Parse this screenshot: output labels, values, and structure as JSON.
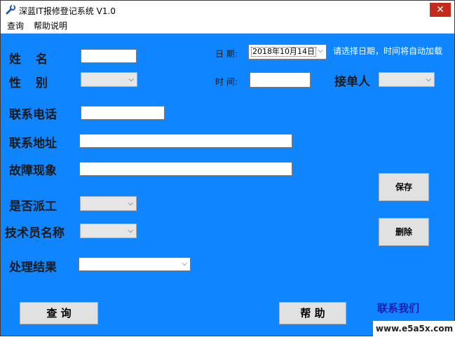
{
  "window": {
    "title": "深蓝IT报修登记系统 V1.0",
    "close_glyph": "✕",
    "icon": "wrench-icon"
  },
  "menu": [
    "查询",
    "帮助说明"
  ],
  "form": {
    "name_label": "姓　名",
    "gender_label": "性　别",
    "phone_label": "联系电话",
    "address_label": "联系地址",
    "fault_label": "故障现象",
    "dispatch_label": "是否派工",
    "technician_label": "技术员名称",
    "result_label": "处理结果",
    "date_label": "日 期:",
    "date_value": "2018年10月14日",
    "date_hint": "请选择日期，时间将自动加载",
    "time_label": "时 间:",
    "receiver_label": "接单人"
  },
  "buttons": {
    "save": "保存",
    "delete": "删除",
    "query": "查 询",
    "help": "帮 助"
  },
  "contact_us": "联系我们",
  "watermark": "www.e5a5x.com",
  "colors": {
    "client_bg": "#0f86ff",
    "close_bg": "#c42b1c",
    "contact_text": "#1b1bb3"
  }
}
